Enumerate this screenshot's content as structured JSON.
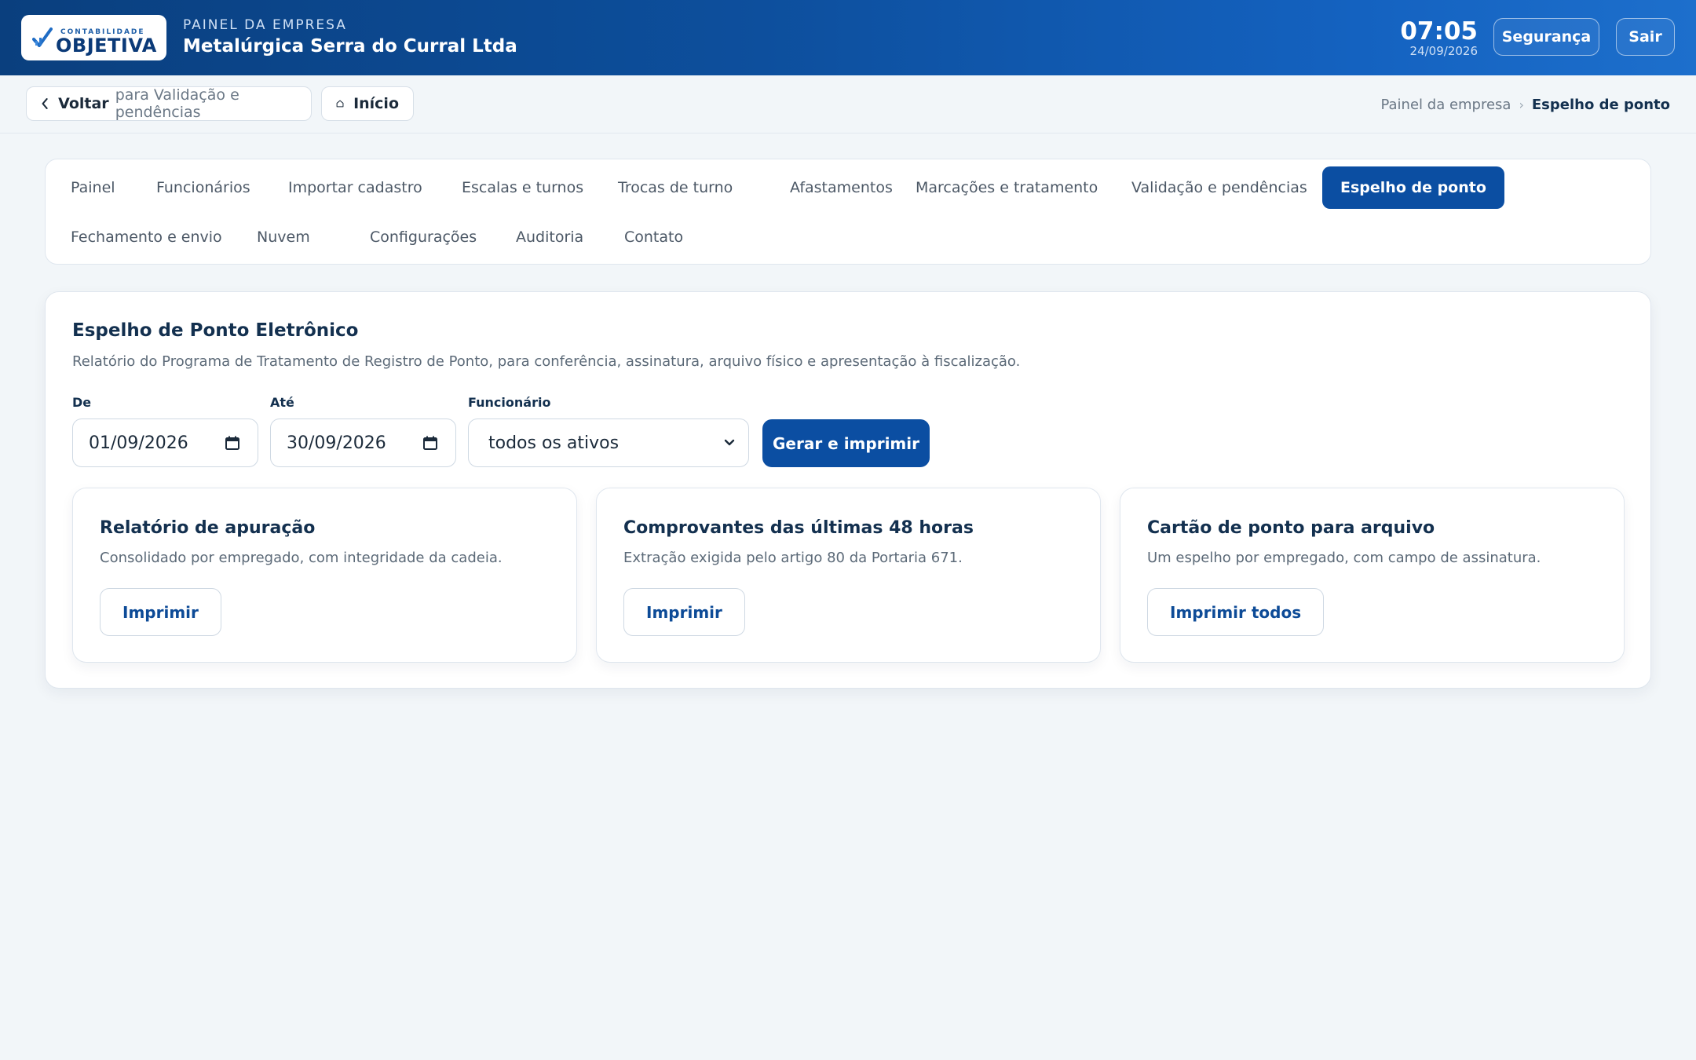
{
  "header": {
    "logo_small": "CONTABILIDADE",
    "logo_big": "OBJETIVA",
    "eyebrow": "PAINEL DA EMPRESA",
    "company": "Metalúrgica Serra do Curral Ltda",
    "time": "07:05",
    "date": "24/09/2026",
    "security_label": "Segurança",
    "logout_label": "Sair"
  },
  "subbar": {
    "back_strong": "Voltar",
    "back_muted": "para Validação e pendências",
    "home_label": "Início",
    "breadcrumb": [
      "Painel da empresa",
      "Espelho de ponto"
    ],
    "breadcrumb_sep": "›"
  },
  "tabs": [
    {
      "label": "Painel"
    },
    {
      "label": "Funcionários"
    },
    {
      "label": "Importar cadastro"
    },
    {
      "label": "Escalas e turnos"
    },
    {
      "label": "Trocas de turno"
    },
    {
      "label": "Afastamentos"
    },
    {
      "label": "Marcações e tratamento"
    },
    {
      "label": "Validação e pendências"
    },
    {
      "label": "Espelho de ponto",
      "active": true
    },
    {
      "label": "Fechamento e envio"
    },
    {
      "label": "Nuvem"
    },
    {
      "label": "Configurações"
    },
    {
      "label": "Auditoria"
    },
    {
      "label": "Contato"
    }
  ],
  "main": {
    "title": "Espelho de Ponto Eletrônico",
    "description": "Relatório do Programa de Tratamento de Registro de Ponto, para conferência, assinatura, arquivo físico e apresentação à fiscalização.",
    "from_label": "De",
    "from_value": "01/09/2026",
    "to_label": "Até",
    "to_value": "30/09/2026",
    "employee_label": "Funcionário",
    "employee_value": "todos os ativos",
    "generate_label": "Gerar e imprimir"
  },
  "reports": [
    {
      "title": "Relatório de apuração",
      "description": "Consolidado por empregado, com integridade da cadeia.",
      "button": "Imprimir"
    },
    {
      "title": "Comprovantes das últimas 48 horas",
      "description": "Extração exigida pelo artigo 80 da Portaria 671.",
      "button": "Imprimir"
    },
    {
      "title": "Cartão de ponto para arquivo",
      "description": "Um espelho por empregado, com campo de assinatura.",
      "button": "Imprimir todos"
    }
  ],
  "colors": {
    "primary": "#0b4ea2",
    "header_gradient_start": "#0a3f7e",
    "header_gradient_end": "#1d6fcc",
    "background": "#f2f6f9"
  }
}
